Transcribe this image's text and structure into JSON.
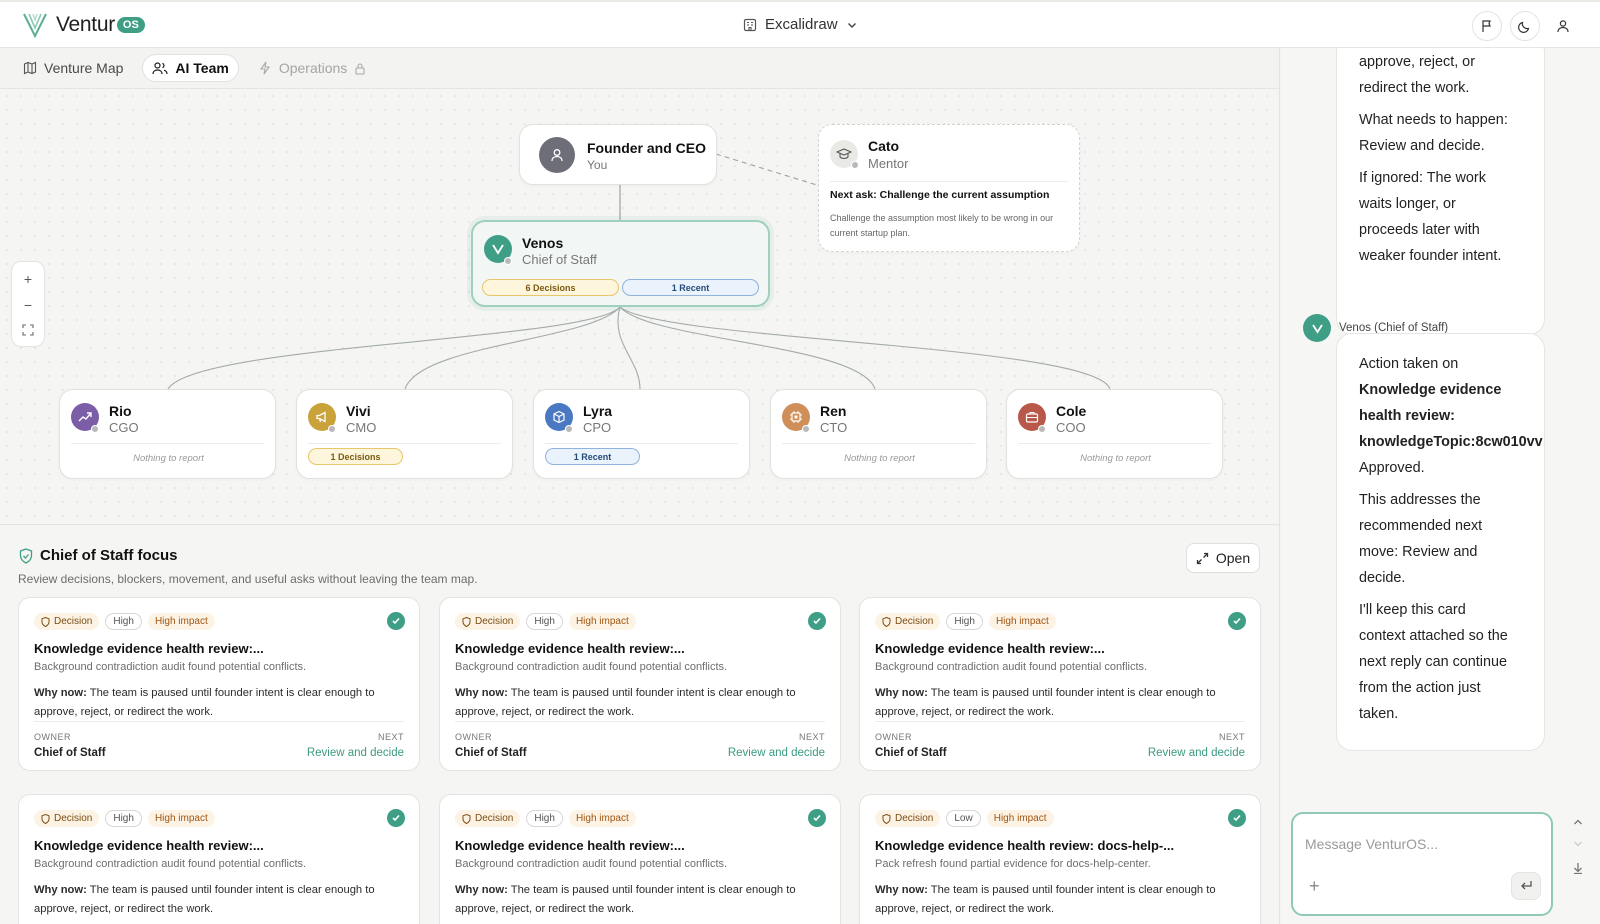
{
  "app": {
    "name": "Ventur",
    "badge": "OS"
  },
  "workspace": {
    "name": "Excalidraw"
  },
  "tabs": [
    {
      "label": "Venture Map"
    },
    {
      "label": "AI Team"
    },
    {
      "label": "Operations"
    }
  ],
  "org": {
    "founder": {
      "name": "Founder and CEO",
      "role": "You"
    },
    "mentor": {
      "name": "Cato",
      "role": "Mentor",
      "ask": "Next ask: Challenge the current assumption",
      "detail": "Challenge the assumption most likely to be wrong in our current startup plan."
    },
    "chief": {
      "name": "Venos",
      "role": "Chief of Staff",
      "decisions": "6 Decisions",
      "recent": "1 Recent"
    },
    "team": [
      {
        "name": "Rio",
        "role": "CGO",
        "note": "Nothing to report",
        "color": "#7b5ea7"
      },
      {
        "name": "Vivi",
        "role": "CMO",
        "pill": "1 Decisions",
        "color": "#c9a23a"
      },
      {
        "name": "Lyra",
        "role": "CPO",
        "pill": "1 Recent",
        "color": "#4a78c2"
      },
      {
        "name": "Ren",
        "role": "CTO",
        "note": "Nothing to report",
        "color": "#d08f58"
      },
      {
        "name": "Cole",
        "role": "COO",
        "note": "Nothing to report",
        "color": "#b8574a"
      }
    ]
  },
  "focus": {
    "title": "Chief of Staff focus",
    "subtitle": "Review decisions, blockers, movement, and useful asks without leaving the team map.",
    "open_label": "Open",
    "cards": [
      {
        "type": "Decision",
        "priority": "High",
        "impact": "High impact",
        "title": "Knowledge evidence health review:...",
        "desc": "Background contradiction audit found potential conflicts.",
        "why_label": "Why now:",
        "why": " The team is paused until founder intent is clear enough to approve, reject, or redirect the work.",
        "owner_label": "OWNER",
        "owner": "Chief of Staff",
        "next_label": "NEXT",
        "next": "Review and decide"
      },
      {
        "type": "Decision",
        "priority": "High",
        "impact": "High impact",
        "title": "Knowledge evidence health review:...",
        "desc": "Background contradiction audit found potential conflicts.",
        "why_label": "Why now:",
        "why": " The team is paused until founder intent is clear enough to approve, reject, or redirect the work.",
        "owner_label": "OWNER",
        "owner": "Chief of Staff",
        "next_label": "NEXT",
        "next": "Review and decide"
      },
      {
        "type": "Decision",
        "priority": "High",
        "impact": "High impact",
        "title": "Knowledge evidence health review:...",
        "desc": "Background contradiction audit found potential conflicts.",
        "why_label": "Why now:",
        "why": " The team is paused until founder intent is clear enough to approve, reject, or redirect the work.",
        "owner_label": "OWNER",
        "owner": "Chief of Staff",
        "next_label": "NEXT",
        "next": "Review and decide"
      },
      {
        "type": "Decision",
        "priority": "High",
        "impact": "High impact",
        "title": "Knowledge evidence health review:...",
        "desc": "Background contradiction audit found potential conflicts.",
        "why_label": "Why now:",
        "why": " The team is paused until founder intent is clear enough to approve, reject, or redirect the work."
      },
      {
        "type": "Decision",
        "priority": "High",
        "impact": "High impact",
        "title": "Knowledge evidence health review:...",
        "desc": "Background contradiction audit found potential conflicts.",
        "why_label": "Why now:",
        "why": " The team is paused until founder intent is clear enough to approve, reject, or redirect the work."
      },
      {
        "type": "Decision",
        "priority": "Low",
        "impact": "High impact",
        "title": "Knowledge evidence health review: docs-help-...",
        "desc": "Pack refresh found partial evidence for docs-help-center.",
        "why_label": "Why now:",
        "why": " The team is paused until founder intent is clear enough to approve, reject, or redirect the work."
      }
    ]
  },
  "chat": {
    "prev_bubble": [
      "approve, reject, or",
      "redirect the work.",
      "What needs to happen:",
      "Review and decide.",
      "If ignored: The work",
      "waits longer, or",
      "proceeds later with",
      "weaker founder intent."
    ],
    "sender": "Venos (Chief of Staff)",
    "message": {
      "intro": "Action taken on",
      "bold1": "Knowledge evidence",
      "bold2": "health review:",
      "bold3": "knowledgeTopic:8cw010vv",
      "status": "Approved.",
      "p2": [
        "This addresses the",
        "recommended next",
        "move: Review and",
        "decide."
      ],
      "p3": [
        "I'll keep this card",
        "context attached so the",
        "next reply can continue",
        "from the action just",
        "taken."
      ]
    },
    "composer_placeholder": "Message VenturOS..."
  },
  "colors": {
    "accent": "#3f9f86",
    "decision_bg": "#fdf3e4",
    "recent_border": "#8fb3dd"
  }
}
